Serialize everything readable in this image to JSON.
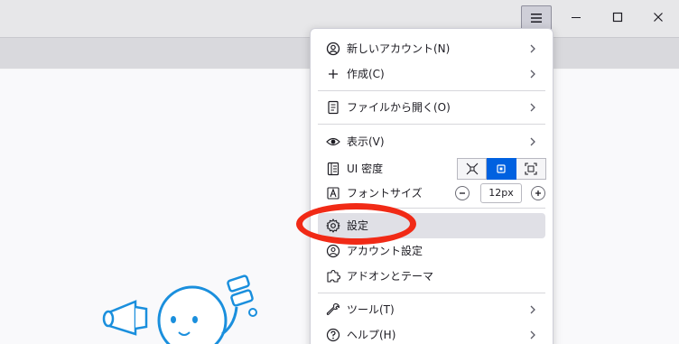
{
  "window": {
    "minimize_icon": "minimize-icon",
    "maximize_icon": "maximize-icon",
    "close_icon": "close-icon",
    "menu_icon": "hamburger-menu-icon"
  },
  "menu": {
    "items": [
      {
        "label": "新しいアカウント(N)",
        "icon": "new-account-icon",
        "submenu": true
      },
      {
        "label": "作成(C)",
        "icon": "plus-icon",
        "submenu": true
      },
      {
        "label": "ファイルから開く(O)",
        "icon": "file-icon",
        "submenu": true
      },
      {
        "label": "表示(V)",
        "icon": "eye-icon",
        "submenu": true
      },
      {
        "label": "UI 密度",
        "icon": "density-icon",
        "submenu": false
      },
      {
        "label": "フォントサイズ",
        "icon": "font-size-icon",
        "submenu": false
      },
      {
        "label": "設定",
        "icon": "gear-icon",
        "submenu": false,
        "highlighted": true
      },
      {
        "label": "アカウント設定",
        "icon": "account-settings-icon",
        "submenu": false
      },
      {
        "label": "アドオンとテーマ",
        "icon": "puzzle-icon",
        "submenu": false
      },
      {
        "label": "ツール(T)",
        "icon": "wrench-icon",
        "submenu": true
      },
      {
        "label": "ヘルプ(H)",
        "icon": "help-icon",
        "submenu": true
      }
    ],
    "density_selected": "normal",
    "font_size_value": "12px"
  },
  "colors": {
    "accent": "#0061e0",
    "annotation": "#f12a16"
  }
}
